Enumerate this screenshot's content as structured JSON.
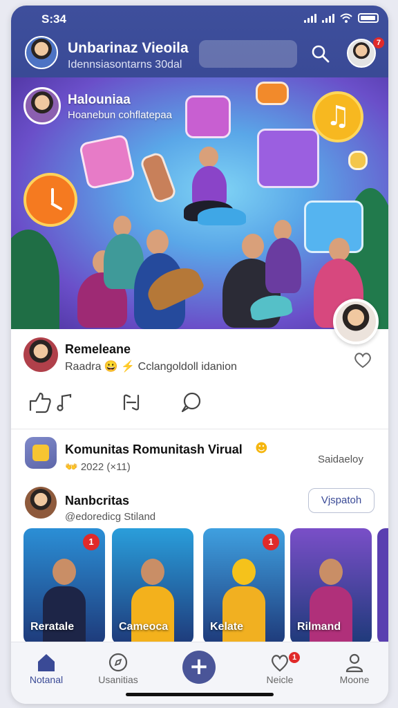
{
  "status_bar": {
    "time": "S:34"
  },
  "header": {
    "title": "Unbarinaz Vieoila",
    "subtitle": "Idennsiasontarns 30dal",
    "notification_count": "7"
  },
  "hero": {
    "title": "Halouniaa",
    "subtitle": "Hoanebun cohflatepaa"
  },
  "post": {
    "name": "Remeleane",
    "meta": "Raadra 😀 ⚡ Cclangoldoll idanion"
  },
  "community": {
    "title": "Komunitas Romunitash Virual",
    "emoji": "☻",
    "date": "👐 2022 (×11)",
    "action": "Saidaeloy"
  },
  "member": {
    "name": "Nanbcritas",
    "handle": "@edoredicg Stiland",
    "button": "Vjspatoh"
  },
  "stories": [
    {
      "label": "Reratale",
      "badge": "1",
      "bg": "#2b8fd6",
      "body": "#1d2547"
    },
    {
      "label": "Cameoca",
      "badge": "",
      "bg": "#2a9edb",
      "body": "#f3b11c"
    },
    {
      "label": "Kelate",
      "badge": "1",
      "bg": "#3fa0e0",
      "body": "#f1b021"
    },
    {
      "label": "Rilmand",
      "badge": "",
      "bg": "#7a4fc8",
      "body": "#b0307a"
    }
  ],
  "nav": {
    "home": "Notanal",
    "explore": "Usanitias",
    "notifications": "Neicle",
    "notifications_badge": "1",
    "profile": "Moone"
  },
  "colors": {
    "header": "#3e4f9c",
    "accent": "#3a4a96",
    "badge": "#e02a2a",
    "music": "#f7b820"
  }
}
